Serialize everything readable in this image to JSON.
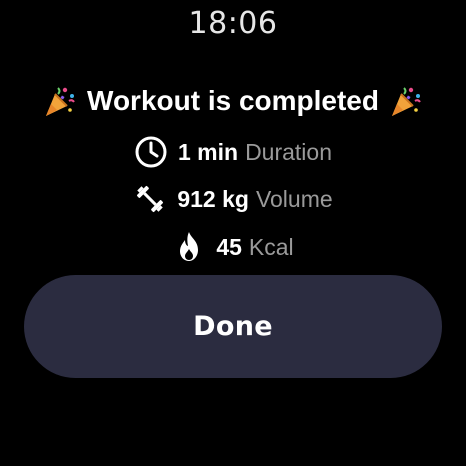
{
  "status_bar": {
    "time": "18:06"
  },
  "summary": {
    "title": "Workout is completed",
    "title_icon": "party-popper-icon"
  },
  "stats": [
    {
      "icon": "clock-icon",
      "value": "1 min",
      "label": "Duration"
    },
    {
      "icon": "dumbbell-icon",
      "value": "912 kg",
      "label": "Volume"
    },
    {
      "icon": "flame-icon",
      "value": "45",
      "label": "Kcal"
    }
  ],
  "actions": {
    "done_label": "Done"
  },
  "colors": {
    "background": "#000000",
    "button_bg": "#2b2c40",
    "muted_text": "#9a9a9a",
    "primary_text": "#ffffff"
  }
}
